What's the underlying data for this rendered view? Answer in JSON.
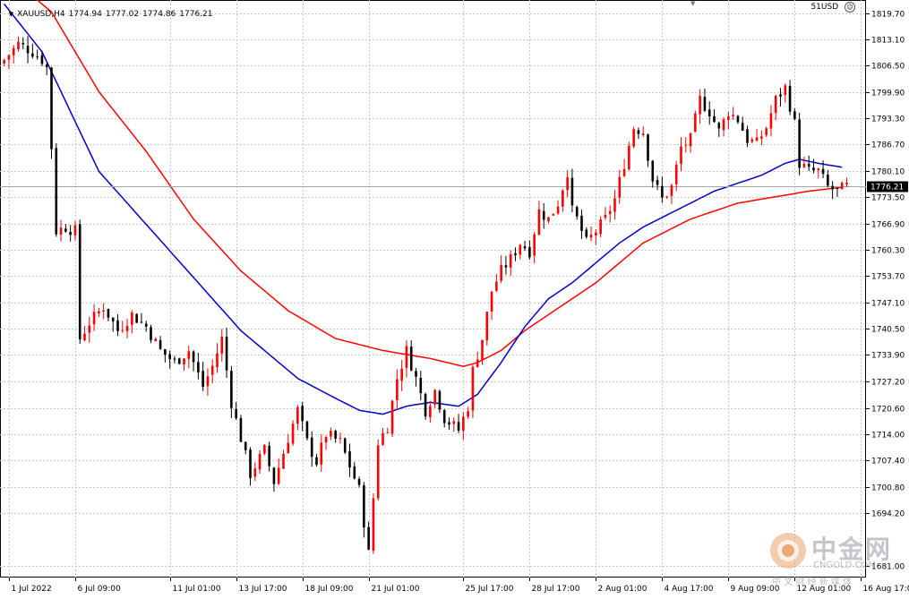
{
  "header": {
    "symbol": "XAUUSD,H4",
    "open": "1774.94",
    "high": "1777.02",
    "low": "1774.86",
    "close": "1776.21",
    "account": "51USD"
  },
  "watermark": {
    "brand": "中金网",
    "domain": "CNGOLD.COM",
    "tagline": "中 文 财 经 新 媒 体",
    "logo_color": "#e07a2a"
  },
  "colors": {
    "bull": "#ff0000",
    "bear": "#000000",
    "ma_fast": "#0000cc",
    "ma_slow": "#ff0000",
    "grid": "#c8c8c8",
    "price_line": "#a0a8b0"
  },
  "chart_data": {
    "type": "candlestick",
    "title": "",
    "xlabel": "",
    "ylabel": "",
    "ylim": [
      1678.0,
      1823.0
    ],
    "grid": true,
    "y_ticks": [
      "1819.70",
      "1813.10",
      "1806.50",
      "1799.90",
      "1793.30",
      "1786.70",
      "1780.10",
      "1773.50",
      "1766.90",
      "1760.30",
      "1753.70",
      "1747.10",
      "1740.50",
      "1733.90",
      "1727.20",
      "1720.60",
      "1714.00",
      "1707.40",
      "1700.80",
      "1694.20",
      "1681.00"
    ],
    "x_tick_labels": [
      "1 Jul 2022",
      "6 Jul 09:00",
      "11 Jul 01:00",
      "13 Jul 17:00",
      "18 Jul 09:00",
      "21 Jul 01:00",
      "25 Jul 17:00",
      "28 Jul 17:00",
      "2 Aug 01:00",
      "4 Aug 17:00",
      "9 Aug 09:00",
      "12 Aug 01:00",
      "16 Aug 17:00"
    ],
    "x_tick_bars": [
      1,
      15,
      35,
      49,
      63,
      77,
      97,
      111,
      125,
      139,
      153,
      167,
      181
    ],
    "current_price": "1776.21",
    "close_keypoints": [
      [
        0,
        1808
      ],
      [
        3,
        1812
      ],
      [
        6,
        1810
      ],
      [
        8,
        1808
      ],
      [
        9,
        1806
      ],
      [
        10,
        1786
      ],
      [
        11,
        1765
      ],
      [
        13,
        1766
      ],
      [
        15,
        1765
      ],
      [
        16,
        1738
      ],
      [
        18,
        1742
      ],
      [
        21,
        1746
      ],
      [
        24,
        1740
      ],
      [
        27,
        1744
      ],
      [
        30,
        1741
      ],
      [
        33,
        1735
      ],
      [
        36,
        1732
      ],
      [
        39,
        1735
      ],
      [
        42,
        1726
      ],
      [
        44,
        1731
      ],
      [
        46,
        1738
      ],
      [
        48,
        1722
      ],
      [
        50,
        1713
      ],
      [
        52,
        1704
      ],
      [
        55,
        1710
      ],
      [
        57,
        1702
      ],
      [
        60,
        1713
      ],
      [
        62,
        1720
      ],
      [
        64,
        1712
      ],
      [
        66,
        1707
      ],
      [
        68,
        1714
      ],
      [
        71,
        1712
      ],
      [
        73,
        1706
      ],
      [
        75,
        1700
      ],
      [
        77,
        1684
      ],
      [
        79,
        1712
      ],
      [
        81,
        1716
      ],
      [
        83,
        1728
      ],
      [
        85,
        1735
      ],
      [
        87,
        1728
      ],
      [
        89,
        1720
      ],
      [
        91,
        1725
      ],
      [
        93,
        1718
      ],
      [
        96,
        1715
      ],
      [
        98,
        1721
      ],
      [
        99,
        1730
      ],
      [
        101,
        1738
      ],
      [
        103,
        1750
      ],
      [
        105,
        1755
      ],
      [
        107,
        1758
      ],
      [
        109,
        1762
      ],
      [
        111,
        1760
      ],
      [
        113,
        1770
      ],
      [
        115,
        1768
      ],
      [
        117,
        1772
      ],
      [
        118,
        1776
      ],
      [
        119,
        1780
      ],
      [
        120,
        1770
      ],
      [
        121,
        1768
      ],
      [
        123,
        1762
      ],
      [
        125,
        1765
      ],
      [
        127,
        1768
      ],
      [
        129,
        1773
      ],
      [
        131,
        1782
      ],
      [
        133,
        1791
      ],
      [
        135,
        1790
      ],
      [
        137,
        1778
      ],
      [
        139,
        1773
      ],
      [
        141,
        1776
      ],
      [
        143,
        1786
      ],
      [
        145,
        1788
      ],
      [
        147,
        1798
      ],
      [
        149,
        1795
      ],
      [
        151,
        1790
      ],
      [
        153,
        1795
      ],
      [
        155,
        1793
      ],
      [
        157,
        1788
      ],
      [
        159,
        1787
      ],
      [
        161,
        1791
      ],
      [
        163,
        1798
      ],
      [
        165,
        1801
      ],
      [
        167,
        1792
      ],
      [
        168,
        1782
      ],
      [
        170,
        1780
      ],
      [
        172,
        1780
      ],
      [
        174,
        1776
      ],
      [
        176,
        1775
      ],
      [
        178,
        1776.21
      ]
    ],
    "ma_fast_keypoints": [
      [
        0,
        1822
      ],
      [
        8,
        1810
      ],
      [
        20,
        1780
      ],
      [
        35,
        1760
      ],
      [
        50,
        1740
      ],
      [
        62,
        1728
      ],
      [
        70,
        1723
      ],
      [
        75,
        1720
      ],
      [
        80,
        1719
      ],
      [
        85,
        1721
      ],
      [
        90,
        1722
      ],
      [
        96,
        1721
      ],
      [
        100,
        1724
      ],
      [
        105,
        1732
      ],
      [
        110,
        1741
      ],
      [
        115,
        1748
      ],
      [
        120,
        1752
      ],
      [
        125,
        1757
      ],
      [
        130,
        1762
      ],
      [
        135,
        1766
      ],
      [
        140,
        1769
      ],
      [
        145,
        1772
      ],
      [
        150,
        1775
      ],
      [
        155,
        1777
      ],
      [
        160,
        1779
      ],
      [
        165,
        1782
      ],
      [
        168,
        1783
      ],
      [
        172,
        1782
      ],
      [
        177,
        1781
      ]
    ],
    "ma_slow_keypoints": [
      [
        0,
        1830
      ],
      [
        10,
        1820
      ],
      [
        20,
        1800
      ],
      [
        30,
        1785
      ],
      [
        40,
        1768
      ],
      [
        50,
        1755
      ],
      [
        60,
        1745
      ],
      [
        70,
        1738
      ],
      [
        80,
        1735
      ],
      [
        90,
        1733
      ],
      [
        97,
        1731
      ],
      [
        100,
        1732
      ],
      [
        105,
        1735
      ],
      [
        110,
        1740
      ],
      [
        115,
        1744
      ],
      [
        120,
        1748
      ],
      [
        125,
        1752
      ],
      [
        130,
        1757
      ],
      [
        135,
        1762
      ],
      [
        140,
        1765
      ],
      [
        145,
        1768
      ],
      [
        150,
        1770
      ],
      [
        155,
        1772
      ],
      [
        160,
        1773
      ],
      [
        165,
        1774
      ],
      [
        170,
        1775
      ],
      [
        177,
        1776
      ]
    ],
    "bars": 182
  }
}
